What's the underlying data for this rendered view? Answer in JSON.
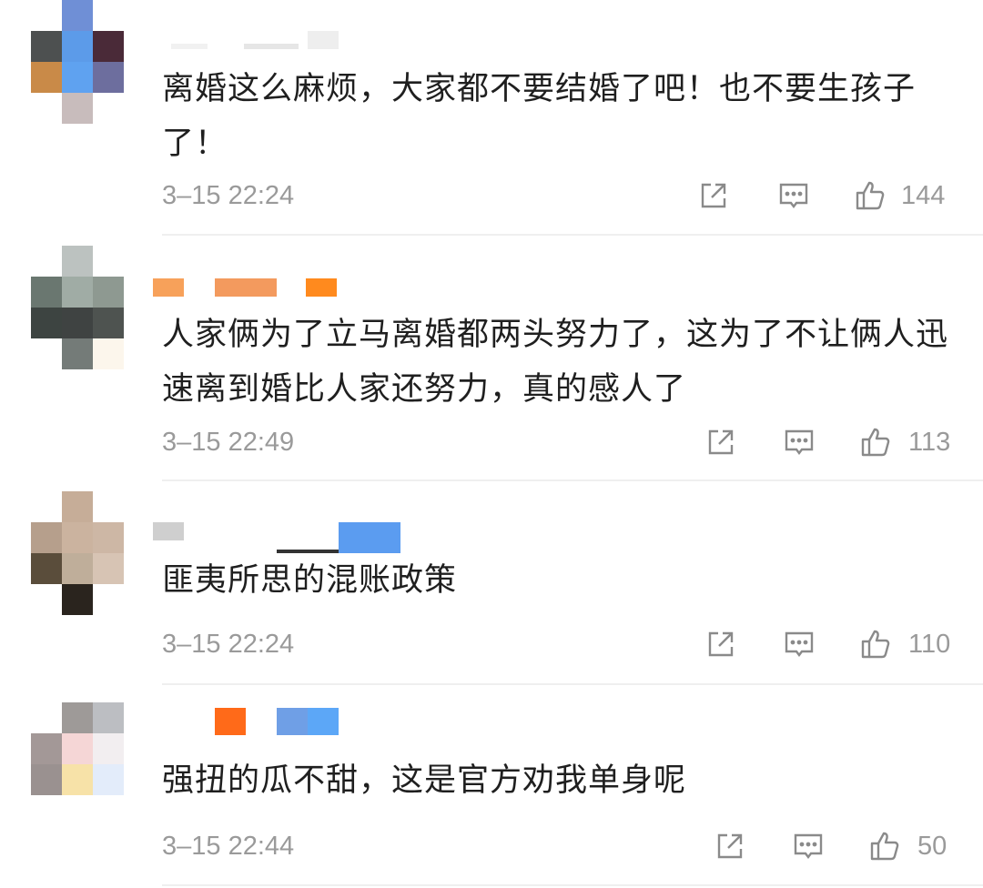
{
  "comments": [
    {
      "text": "离婚这么麻烦，大家都不要结婚了吧！也不要生孩子了！",
      "time": "3-15 22:24",
      "likes": "144",
      "avatar_colors": [
        "#6f8fd6",
        "#4d5050",
        "#5c9be9",
        "#4a2a38",
        "#c98a48",
        "#5fa2f0",
        "#6d6e9e",
        "#c8bcbc"
      ],
      "nick_colors": [
        "#eeeeee",
        "#e4e4e4",
        "#f0f0f0"
      ]
    },
    {
      "text": "人家俩为了立马离婚都两头努力了，这为了不让俩人迅速离到婚比人家还努力，真的感人了",
      "time": "3-15 22:49",
      "likes": "113",
      "avatar_colors": [
        "#bcc2c0",
        "#6a7770",
        "#a0aca5",
        "#8e9991",
        "#3d4441",
        "#3f4342",
        "#4e5350",
        "#747b78"
      ],
      "nick_colors": [
        "#f7a15a",
        "#f39a5e",
        "#ff8a1e"
      ]
    },
    {
      "text": "匪夷所思的混账政策",
      "time": "3-15 22:24",
      "likes": "110",
      "avatar_colors": [
        "#c6ad98",
        "#b69f8c",
        "#cbb39f",
        "#cdb7a5",
        "#5a4d3b",
        "#bfae9a",
        "#d7c4b4",
        "#2a241e"
      ],
      "nick_colors": [
        "#cfcfcf",
        "#333333",
        "#5b9cf0"
      ]
    },
    {
      "text": "强扭的瓜不甜，这是官方劝我单身呢",
      "time": "3-15 22:44",
      "likes": "50",
      "avatar_colors": [
        "#9e9a98",
        "#bcbec2",
        "#d3c8c8",
        "#f5d6d6",
        "#f2eef0",
        "#a39897",
        "#f7e2a8",
        "#e3ecfa"
      ],
      "nick_colors": [
        "#ff6a19",
        "#6f9fe6",
        "#5ca7f7"
      ]
    }
  ],
  "icons": {
    "share": "share-icon",
    "comment": "comment-icon",
    "like": "thumbs-up-icon"
  }
}
